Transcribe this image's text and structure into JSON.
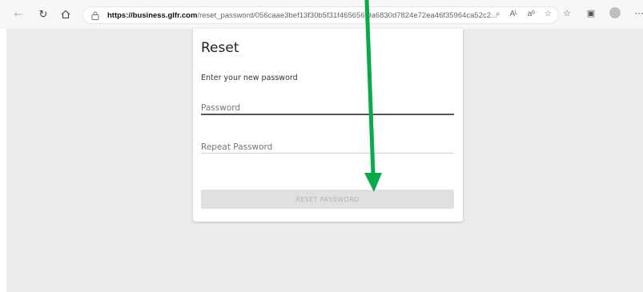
{
  "browser": {
    "url_host": "https://business.glfr.com",
    "url_path": "/reset_password/056caae3bef13f30b5f31f465656f9a6830d7824e72ea46f35964ca52c2...",
    "icons": [
      "back-icon",
      "refresh-icon",
      "home-icon",
      "lock-icon",
      "zoom-icon",
      "read-aloud-icon",
      "translate-icon",
      "favorite-icon",
      "favorites-icon",
      "collections-icon",
      "profile-icon",
      "more-icon"
    ]
  },
  "form": {
    "title": "Reset",
    "subtitle": "Enter your new password",
    "password_placeholder": "Password",
    "repeat_placeholder": "Repeat Password",
    "button_label": "RESET PASSWORD"
  },
  "colors": {
    "annotation_arrow": "#0aaa4a",
    "page_background": "#ebebeb"
  }
}
